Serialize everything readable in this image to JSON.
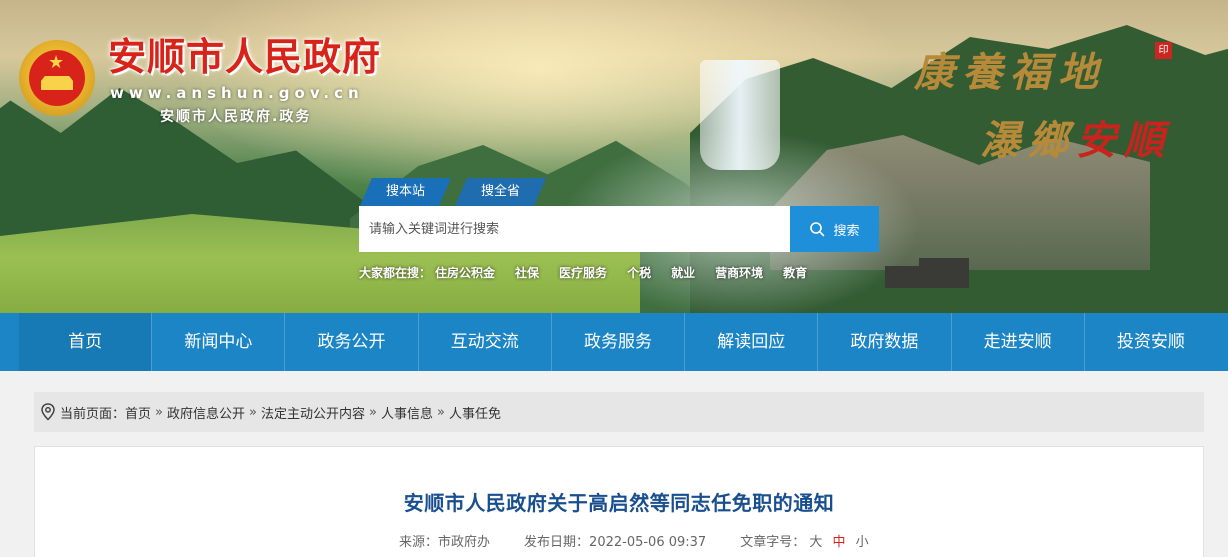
{
  "header": {
    "site_title": "安顺市人民政府",
    "site_url": "www.anshun.gov.cn",
    "site_subtitle": "安顺市人民政府.政务",
    "slogan_line1": "康養福地",
    "slogan_line2a": "瀑鄉",
    "slogan_line2b": "安順"
  },
  "search": {
    "tabs": [
      "搜本站",
      "搜全省"
    ],
    "placeholder": "请输入关键词进行搜索",
    "button_label": "搜索",
    "hot_label": "大家都在搜：",
    "hot_terms": [
      "住房公积金",
      "社保",
      "医疗服务",
      "个税",
      "就业",
      "营商环境",
      "教育"
    ]
  },
  "nav": {
    "items": [
      "首页",
      "新闻中心",
      "政务公开",
      "互动交流",
      "政务服务",
      "解读回应",
      "政府数据",
      "走进安顺",
      "投资安顺"
    ]
  },
  "breadcrumb": {
    "label": "当前页面：",
    "items": [
      "首页",
      "政府信息公开",
      "法定主动公开内容",
      "人事信息",
      "人事任免"
    ],
    "separator": "»"
  },
  "article": {
    "title": "安顺市人民政府关于高启然等同志任免职的通知",
    "source_label": "来源：",
    "source": "市政府办",
    "date_label": "发布日期：",
    "date": "2022-05-06 09:37",
    "font_size_label": "文章字号：",
    "font_large": "大",
    "font_medium": "中",
    "font_small": "小"
  },
  "colors": {
    "nav_bg": "#1c85c6",
    "title_red": "#d8231a",
    "article_title": "#1a4f8f"
  }
}
